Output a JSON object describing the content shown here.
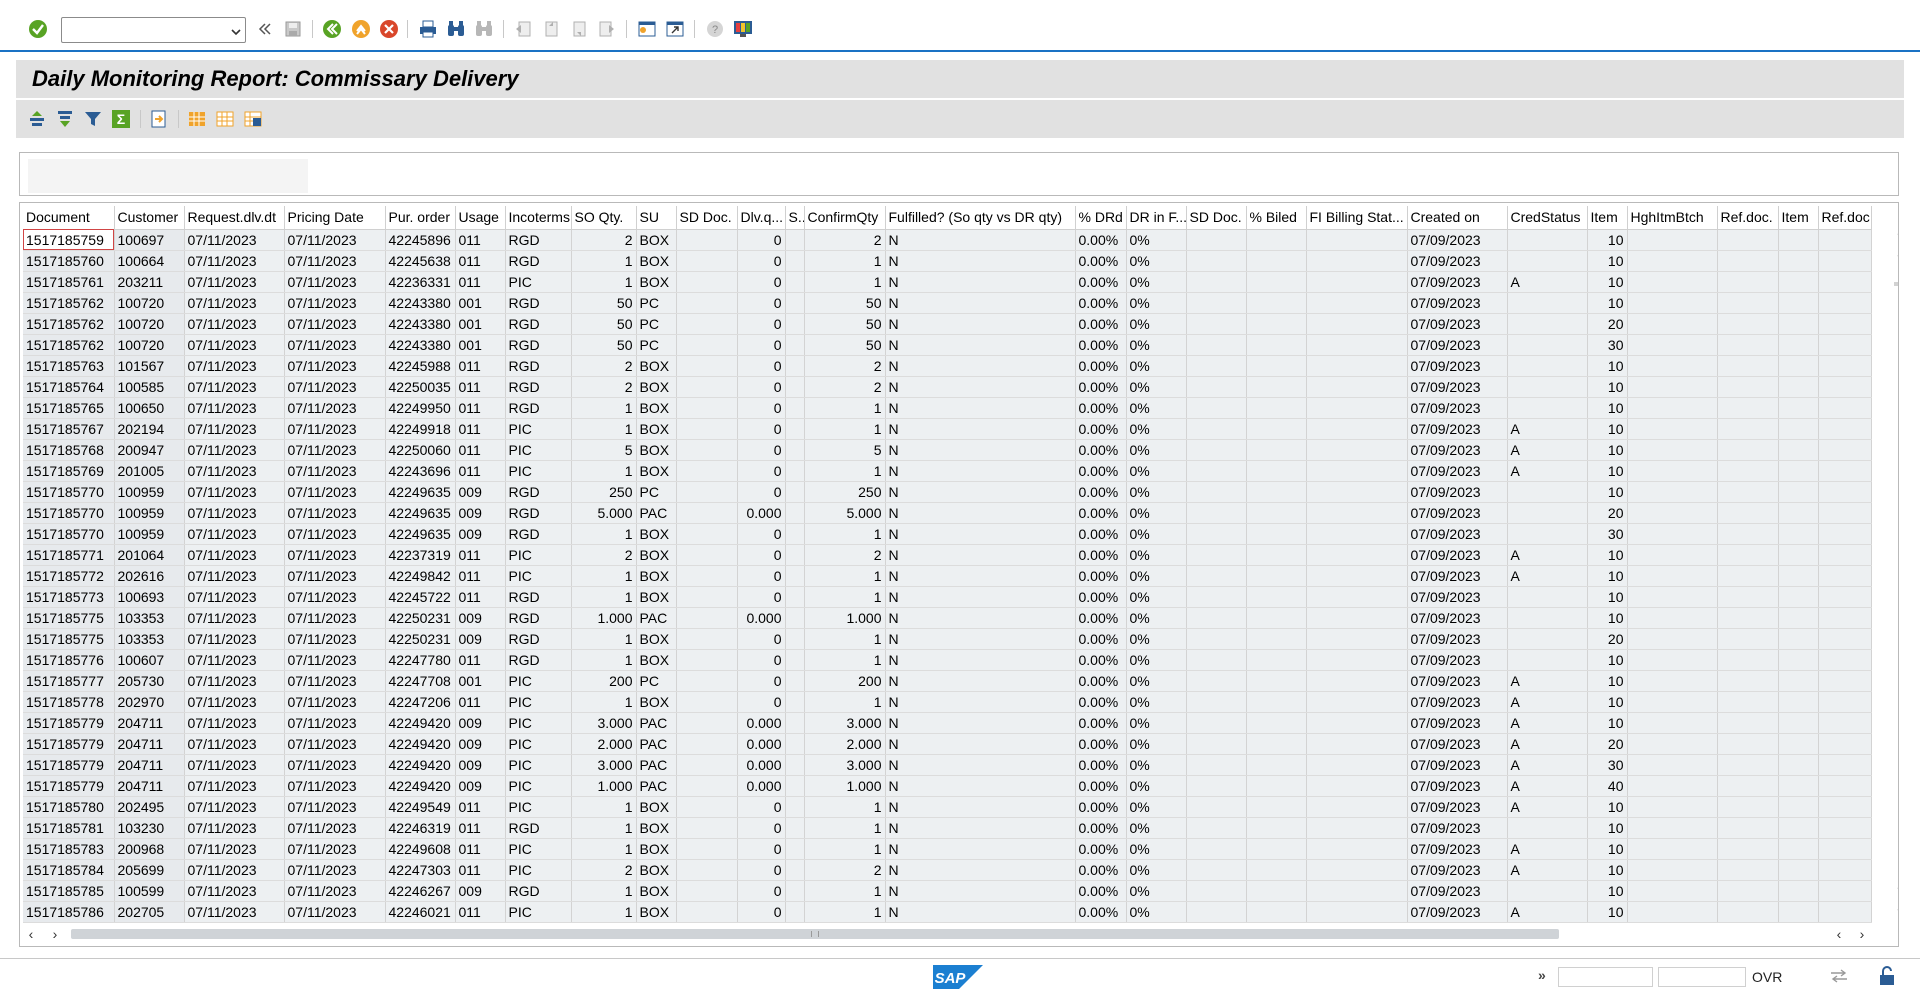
{
  "toolbar": {
    "command_field_value": "",
    "icons": [
      "enter-icon",
      "command-dropdown-icon",
      "back-nav-icon",
      "save-icon",
      "back-icon",
      "exit-icon",
      "cancel-icon",
      "print-icon",
      "find-icon",
      "find-next-icon",
      "first-page-icon",
      "previous-page-icon",
      "next-page-icon",
      "last-page-icon",
      "create-session-icon",
      "shortcut-icon",
      "help-icon",
      "customize-layout-icon"
    ]
  },
  "title": "Daily Monitoring Report: Commissary Delivery",
  "app_toolbar": {
    "icons": [
      "sort-ascending-icon",
      "sort-descending-icon",
      "filter-icon",
      "total-icon",
      "export-icon",
      "select-layout-icon",
      "change-layout-icon",
      "save-layout-icon"
    ]
  },
  "grid": {
    "columns": [
      "Document",
      "Customer",
      "Request.dlv.dt",
      "Pricing Date",
      "Pur. order",
      "Usage",
      "Incoterms",
      "SO Qty.",
      "SU",
      "SD Doc.",
      "Dlv.q...",
      "S...",
      "ConfirmQty",
      "Fulfilled? (So qty vs DR qty)",
      "% DRd",
      "DR in F...",
      "SD Doc.",
      "% Biled",
      "FI Billing Stat...",
      "Created on",
      "CredStatus",
      "Item",
      "HghItmBtch",
      "Ref.doc.",
      "Item",
      "Ref.doc."
    ],
    "rows": [
      [
        "1517185759",
        "100697",
        "07/11/2023",
        "07/11/2023",
        "42245896",
        "011",
        "RGD",
        "2",
        "BOX",
        "",
        "0",
        "",
        "2",
        "N",
        "0.00%",
        "0%",
        "",
        "",
        "",
        "07/09/2023",
        "",
        "10",
        "",
        "",
        "",
        ""
      ],
      [
        "1517185760",
        "100664",
        "07/11/2023",
        "07/11/2023",
        "42245638",
        "011",
        "RGD",
        "1",
        "BOX",
        "",
        "0",
        "",
        "1",
        "N",
        "0.00%",
        "0%",
        "",
        "",
        "",
        "07/09/2023",
        "",
        "10",
        "",
        "",
        "",
        ""
      ],
      [
        "1517185761",
        "203211",
        "07/11/2023",
        "07/11/2023",
        "42236331",
        "011",
        "PIC",
        "1",
        "BOX",
        "",
        "0",
        "",
        "1",
        "N",
        "0.00%",
        "0%",
        "",
        "",
        "",
        "07/09/2023",
        "A",
        "10",
        "",
        "",
        "",
        ""
      ],
      [
        "1517185762",
        "100720",
        "07/11/2023",
        "07/11/2023",
        "42243380",
        "001",
        "RGD",
        "50",
        "PC",
        "",
        "0",
        "",
        "50",
        "N",
        "0.00%",
        "0%",
        "",
        "",
        "",
        "07/09/2023",
        "",
        "10",
        "",
        "",
        "",
        ""
      ],
      [
        "1517185762",
        "100720",
        "07/11/2023",
        "07/11/2023",
        "42243380",
        "001",
        "RGD",
        "50",
        "PC",
        "",
        "0",
        "",
        "50",
        "N",
        "0.00%",
        "0%",
        "",
        "",
        "",
        "07/09/2023",
        "",
        "20",
        "",
        "",
        "",
        ""
      ],
      [
        "1517185762",
        "100720",
        "07/11/2023",
        "07/11/2023",
        "42243380",
        "001",
        "RGD",
        "50",
        "PC",
        "",
        "0",
        "",
        "50",
        "N",
        "0.00%",
        "0%",
        "",
        "",
        "",
        "07/09/2023",
        "",
        "30",
        "",
        "",
        "",
        ""
      ],
      [
        "1517185763",
        "101567",
        "07/11/2023",
        "07/11/2023",
        "42245988",
        "011",
        "RGD",
        "2",
        "BOX",
        "",
        "0",
        "",
        "2",
        "N",
        "0.00%",
        "0%",
        "",
        "",
        "",
        "07/09/2023",
        "",
        "10",
        "",
        "",
        "",
        ""
      ],
      [
        "1517185764",
        "100585",
        "07/11/2023",
        "07/11/2023",
        "42250035",
        "011",
        "RGD",
        "2",
        "BOX",
        "",
        "0",
        "",
        "2",
        "N",
        "0.00%",
        "0%",
        "",
        "",
        "",
        "07/09/2023",
        "",
        "10",
        "",
        "",
        "",
        ""
      ],
      [
        "1517185765",
        "100650",
        "07/11/2023",
        "07/11/2023",
        "42249950",
        "011",
        "RGD",
        "1",
        "BOX",
        "",
        "0",
        "",
        "1",
        "N",
        "0.00%",
        "0%",
        "",
        "",
        "",
        "07/09/2023",
        "",
        "10",
        "",
        "",
        "",
        ""
      ],
      [
        "1517185767",
        "202194",
        "07/11/2023",
        "07/11/2023",
        "42249918",
        "011",
        "PIC",
        "1",
        "BOX",
        "",
        "0",
        "",
        "1",
        "N",
        "0.00%",
        "0%",
        "",
        "",
        "",
        "07/09/2023",
        "A",
        "10",
        "",
        "",
        "",
        ""
      ],
      [
        "1517185768",
        "200947",
        "07/11/2023",
        "07/11/2023",
        "42250060",
        "011",
        "PIC",
        "5",
        "BOX",
        "",
        "0",
        "",
        "5",
        "N",
        "0.00%",
        "0%",
        "",
        "",
        "",
        "07/09/2023",
        "A",
        "10",
        "",
        "",
        "",
        ""
      ],
      [
        "1517185769",
        "201005",
        "07/11/2023",
        "07/11/2023",
        "42243696",
        "011",
        "PIC",
        "1",
        "BOX",
        "",
        "0",
        "",
        "1",
        "N",
        "0.00%",
        "0%",
        "",
        "",
        "",
        "07/09/2023",
        "A",
        "10",
        "",
        "",
        "",
        ""
      ],
      [
        "1517185770",
        "100959",
        "07/11/2023",
        "07/11/2023",
        "42249635",
        "009",
        "RGD",
        "250",
        "PC",
        "",
        "0",
        "",
        "250",
        "N",
        "0.00%",
        "0%",
        "",
        "",
        "",
        "07/09/2023",
        "",
        "10",
        "",
        "",
        "",
        ""
      ],
      [
        "1517185770",
        "100959",
        "07/11/2023",
        "07/11/2023",
        "42249635",
        "009",
        "RGD",
        "5.000",
        "PAC",
        "",
        "0.000",
        "",
        "5.000",
        "N",
        "0.00%",
        "0%",
        "",
        "",
        "",
        "07/09/2023",
        "",
        "20",
        "",
        "",
        "",
        ""
      ],
      [
        "1517185770",
        "100959",
        "07/11/2023",
        "07/11/2023",
        "42249635",
        "009",
        "RGD",
        "1",
        "BOX",
        "",
        "0",
        "",
        "1",
        "N",
        "0.00%",
        "0%",
        "",
        "",
        "",
        "07/09/2023",
        "",
        "30",
        "",
        "",
        "",
        ""
      ],
      [
        "1517185771",
        "201064",
        "07/11/2023",
        "07/11/2023",
        "42237319",
        "011",
        "PIC",
        "2",
        "BOX",
        "",
        "0",
        "",
        "2",
        "N",
        "0.00%",
        "0%",
        "",
        "",
        "",
        "07/09/2023",
        "A",
        "10",
        "",
        "",
        "",
        ""
      ],
      [
        "1517185772",
        "202616",
        "07/11/2023",
        "07/11/2023",
        "42249842",
        "011",
        "PIC",
        "1",
        "BOX",
        "",
        "0",
        "",
        "1",
        "N",
        "0.00%",
        "0%",
        "",
        "",
        "",
        "07/09/2023",
        "A",
        "10",
        "",
        "",
        "",
        ""
      ],
      [
        "1517185773",
        "100693",
        "07/11/2023",
        "07/11/2023",
        "42245722",
        "011",
        "RGD",
        "1",
        "BOX",
        "",
        "0",
        "",
        "1",
        "N",
        "0.00%",
        "0%",
        "",
        "",
        "",
        "07/09/2023",
        "",
        "10",
        "",
        "",
        "",
        ""
      ],
      [
        "1517185775",
        "103353",
        "07/11/2023",
        "07/11/2023",
        "42250231",
        "009",
        "RGD",
        "1.000",
        "PAC",
        "",
        "0.000",
        "",
        "1.000",
        "N",
        "0.00%",
        "0%",
        "",
        "",
        "",
        "07/09/2023",
        "",
        "10",
        "",
        "",
        "",
        ""
      ],
      [
        "1517185775",
        "103353",
        "07/11/2023",
        "07/11/2023",
        "42250231",
        "009",
        "RGD",
        "1",
        "BOX",
        "",
        "0",
        "",
        "1",
        "N",
        "0.00%",
        "0%",
        "",
        "",
        "",
        "07/09/2023",
        "",
        "20",
        "",
        "",
        "",
        ""
      ],
      [
        "1517185776",
        "100607",
        "07/11/2023",
        "07/11/2023",
        "42247780",
        "011",
        "RGD",
        "1",
        "BOX",
        "",
        "0",
        "",
        "1",
        "N",
        "0.00%",
        "0%",
        "",
        "",
        "",
        "07/09/2023",
        "",
        "10",
        "",
        "",
        "",
        ""
      ],
      [
        "1517185777",
        "205730",
        "07/11/2023",
        "07/11/2023",
        "42247708",
        "001",
        "PIC",
        "200",
        "PC",
        "",
        "0",
        "",
        "200",
        "N",
        "0.00%",
        "0%",
        "",
        "",
        "",
        "07/09/2023",
        "A",
        "10",
        "",
        "",
        "",
        ""
      ],
      [
        "1517185778",
        "202970",
        "07/11/2023",
        "07/11/2023",
        "42247206",
        "011",
        "PIC",
        "1",
        "BOX",
        "",
        "0",
        "",
        "1",
        "N",
        "0.00%",
        "0%",
        "",
        "",
        "",
        "07/09/2023",
        "A",
        "10",
        "",
        "",
        "",
        ""
      ],
      [
        "1517185779",
        "204711",
        "07/11/2023",
        "07/11/2023",
        "42249420",
        "009",
        "PIC",
        "3.000",
        "PAC",
        "",
        "0.000",
        "",
        "3.000",
        "N",
        "0.00%",
        "0%",
        "",
        "",
        "",
        "07/09/2023",
        "A",
        "10",
        "",
        "",
        "",
        ""
      ],
      [
        "1517185779",
        "204711",
        "07/11/2023",
        "07/11/2023",
        "42249420",
        "009",
        "PIC",
        "2.000",
        "PAC",
        "",
        "0.000",
        "",
        "2.000",
        "N",
        "0.00%",
        "0%",
        "",
        "",
        "",
        "07/09/2023",
        "A",
        "20",
        "",
        "",
        "",
        ""
      ],
      [
        "1517185779",
        "204711",
        "07/11/2023",
        "07/11/2023",
        "42249420",
        "009",
        "PIC",
        "3.000",
        "PAC",
        "",
        "0.000",
        "",
        "3.000",
        "N",
        "0.00%",
        "0%",
        "",
        "",
        "",
        "07/09/2023",
        "A",
        "30",
        "",
        "",
        "",
        ""
      ],
      [
        "1517185779",
        "204711",
        "07/11/2023",
        "07/11/2023",
        "42249420",
        "009",
        "PIC",
        "1.000",
        "PAC",
        "",
        "0.000",
        "",
        "1.000",
        "N",
        "0.00%",
        "0%",
        "",
        "",
        "",
        "07/09/2023",
        "A",
        "40",
        "",
        "",
        "",
        ""
      ],
      [
        "1517185780",
        "202495",
        "07/11/2023",
        "07/11/2023",
        "42249549",
        "011",
        "PIC",
        "1",
        "BOX",
        "",
        "0",
        "",
        "1",
        "N",
        "0.00%",
        "0%",
        "",
        "",
        "",
        "07/09/2023",
        "A",
        "10",
        "",
        "",
        "",
        ""
      ],
      [
        "1517185781",
        "103230",
        "07/11/2023",
        "07/11/2023",
        "42246319",
        "011",
        "RGD",
        "1",
        "BOX",
        "",
        "0",
        "",
        "1",
        "N",
        "0.00%",
        "0%",
        "",
        "",
        "",
        "07/09/2023",
        "",
        "10",
        "",
        "",
        "",
        ""
      ],
      [
        "1517185783",
        "200968",
        "07/11/2023",
        "07/11/2023",
        "42249608",
        "011",
        "PIC",
        "1",
        "BOX",
        "",
        "0",
        "",
        "1",
        "N",
        "0.00%",
        "0%",
        "",
        "",
        "",
        "07/09/2023",
        "A",
        "10",
        "",
        "",
        "",
        ""
      ],
      [
        "1517185784",
        "205699",
        "07/11/2023",
        "07/11/2023",
        "42247303",
        "011",
        "PIC",
        "2",
        "BOX",
        "",
        "0",
        "",
        "2",
        "N",
        "0.00%",
        "0%",
        "",
        "",
        "",
        "07/09/2023",
        "A",
        "10",
        "",
        "",
        "",
        ""
      ],
      [
        "1517185785",
        "100599",
        "07/11/2023",
        "07/11/2023",
        "42246267",
        "009",
        "RGD",
        "1",
        "BOX",
        "",
        "0",
        "",
        "1",
        "N",
        "0.00%",
        "0%",
        "",
        "",
        "",
        "07/09/2023",
        "",
        "10",
        "",
        "",
        "",
        ""
      ],
      [
        "1517185786",
        "202705",
        "07/11/2023",
        "07/11/2023",
        "42246021",
        "011",
        "PIC",
        "1",
        "BOX",
        "",
        "0",
        "",
        "1",
        "N",
        "0.00%",
        "0%",
        "",
        "",
        "",
        "07/09/2023",
        "A",
        "10",
        "",
        "",
        "",
        ""
      ]
    ]
  },
  "footer": {
    "logo_text": "SAP",
    "mode": "OVR",
    "chevron": "»",
    "status_field_1": "",
    "status_field_2": ""
  },
  "colors": {
    "accent": "#1a72c4",
    "cell_bg": "#edf0f2",
    "header_bar": "#e1e1e1",
    "green_icon": "#58a324",
    "orange_icon": "#f0a32b",
    "red_icon": "#d9472b"
  }
}
